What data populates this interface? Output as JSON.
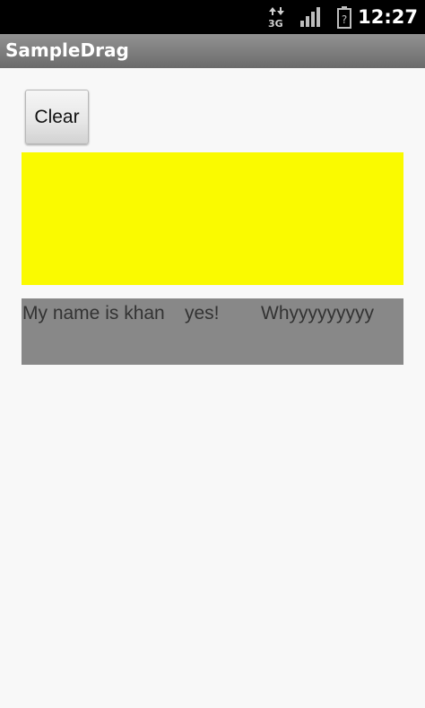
{
  "status_bar": {
    "time": "12:27",
    "network_icon": "3g-data-icon",
    "signal_icon": "signal-strength-icon",
    "battery_icon": "battery-unknown-icon",
    "network_label": "3G",
    "battery_label": "?"
  },
  "app": {
    "title": "SampleDrag"
  },
  "main": {
    "clear_label": "Clear",
    "drop_zone_color": "#fafa00",
    "drag_area_color": "#888888",
    "drag_items": [
      {
        "text": "My name is khan"
      },
      {
        "text": "yes!"
      },
      {
        "text": "Whyyyyyyyyy"
      }
    ]
  }
}
